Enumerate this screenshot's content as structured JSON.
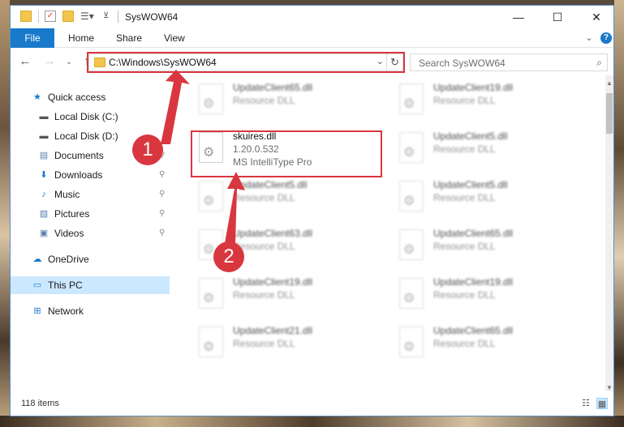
{
  "window": {
    "title": "SysWOW64",
    "controls": {
      "minimize": "—",
      "maximize": "☐",
      "close": "✕"
    }
  },
  "ribbon": {
    "tabs": [
      "File",
      "Home",
      "Share",
      "View"
    ],
    "expand_icon": "chevron-down-icon",
    "help_icon": "help-icon"
  },
  "navbar": {
    "address_path": "C:\\Windows\\SysWOW64",
    "search_placeholder": "Search SysWOW64"
  },
  "nav_pane": {
    "items": [
      {
        "label": "Quick access",
        "icon": "star-icon",
        "pinned": false
      },
      {
        "label": "Local Disk (C:)",
        "icon": "drive-icon",
        "pinned": false
      },
      {
        "label": "Local Disk (D:)",
        "icon": "drive-icon",
        "pinned": false
      },
      {
        "label": "Documents",
        "icon": "documents-icon",
        "pinned": true
      },
      {
        "label": "Downloads",
        "icon": "download-icon",
        "pinned": true
      },
      {
        "label": "Music",
        "icon": "music-icon",
        "pinned": true
      },
      {
        "label": "Pictures",
        "icon": "pictures-icon",
        "pinned": true
      },
      {
        "label": "Videos",
        "icon": "videos-icon",
        "pinned": true
      },
      {
        "label": "OneDrive",
        "icon": "cloud-icon",
        "pinned": false
      },
      {
        "label": "This PC",
        "icon": "computer-icon",
        "pinned": false,
        "selected": true
      },
      {
        "label": "Network",
        "icon": "network-icon",
        "pinned": false
      }
    ]
  },
  "files": {
    "left": [
      {
        "name": "UpdateClient65.dll",
        "type": "Resource DLL"
      },
      {
        "name": "skuires.dll",
        "version": "1.20.0.532",
        "description": "MS IntelliType Pro",
        "highlighted": true
      },
      {
        "name": "UpdateClient5.dll",
        "type": "Resource DLL"
      },
      {
        "name": "UpdateClient63.dll",
        "type": "Resource DLL"
      },
      {
        "name": "UpdateClient19.dll",
        "type": "Resource DLL"
      },
      {
        "name": "UpdateClient21.dll",
        "type": "Resource DLL"
      }
    ],
    "right": [
      {
        "name": "UpdateClient19.dll",
        "type": "Resource DLL"
      },
      {
        "name": "UpdateClient5.dll",
        "type": "Resource DLL"
      },
      {
        "name": "UpdateClient5.dll",
        "type": "Resource DLL"
      },
      {
        "name": "UpdateClient65.dll",
        "type": "Resource DLL"
      },
      {
        "name": "UpdateClient19.dll",
        "type": "Resource DLL"
      },
      {
        "name": "UpdateClient65.dll",
        "type": "Resource DLL"
      }
    ]
  },
  "status": {
    "item_count": "118 items"
  },
  "annotations": {
    "step1": "1",
    "step2": "2",
    "color": "#d9373f"
  }
}
